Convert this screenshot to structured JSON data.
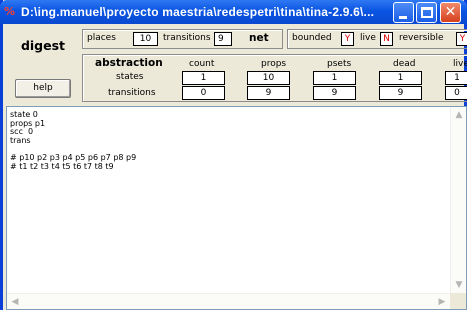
{
  "window": {
    "title": "D:\\ing.manuel\\proyecto maestria\\redespetri\\tina\\tina-2.9.6\\...",
    "icon": "petri-net-icon"
  },
  "left": {
    "digest_label": "digest",
    "help_label": "help"
  },
  "counts": {
    "places_label": "places",
    "places_value": "10",
    "transitions_label": "transitions",
    "transitions_value": "9",
    "net_label": "net"
  },
  "props": {
    "bounded_label": "bounded",
    "bounded_value": "Y",
    "live_label": "live",
    "live_value": "N",
    "reversible_label": "reversible",
    "reversible_value": "Y"
  },
  "table": {
    "title": "abstraction",
    "headers": [
      "count",
      "props",
      "psets",
      "dead",
      "live"
    ],
    "rows": [
      {
        "label": "states",
        "values": [
          "1",
          "10",
          "1",
          "1",
          "1"
        ]
      },
      {
        "label": "transitions",
        "values": [
          "0",
          "9",
          "9",
          "9",
          "0"
        ]
      }
    ]
  },
  "output": {
    "text": "state 0\nprops p1\nscc  0\ntrans\n\n# p10 p2 p3 p4 p5 p6 p7 p8 p9\n# t1 t2 t3 t4 t5 t6 t7 t8 t9"
  },
  "colors": {
    "title_bar": "#0a55e3",
    "value_red": "#e00000"
  }
}
